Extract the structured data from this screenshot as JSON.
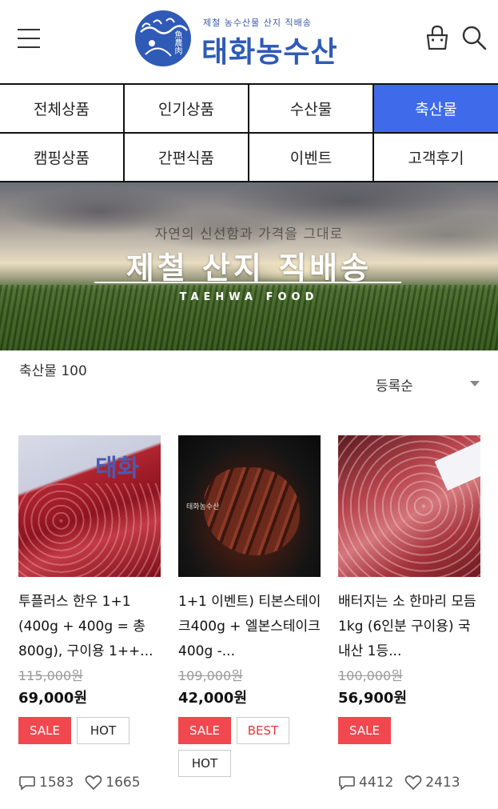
{
  "header": {
    "logo_sub": "제철 농수산물 산지 직배송",
    "logo_main": "태화농수산",
    "logo_emblem_text": "魚農肉"
  },
  "categories": [
    {
      "label": "전체상품",
      "active": false
    },
    {
      "label": "인기상품",
      "active": false
    },
    {
      "label": "수산물",
      "active": false
    },
    {
      "label": "축산물",
      "active": true
    },
    {
      "label": "캠핑상품",
      "active": false
    },
    {
      "label": "간편식품",
      "active": false
    },
    {
      "label": "이벤트",
      "active": false
    },
    {
      "label": "고객후기",
      "active": false
    }
  ],
  "banner": {
    "subtitle": "자연의 신선함과 가격을 그대로",
    "title": "제철 산지 직배송",
    "brand": "TAEHWA FOOD"
  },
  "listing": {
    "count_label": "축산물 100",
    "sort_selected": "등록순"
  },
  "products": [
    {
      "name": "투플러스 한우 1+1 (400g + 400g = 총 800g), 구이용 1++...",
      "original_price": "115,000원",
      "price": "69,000원",
      "badges": [
        "SALE",
        "HOT"
      ],
      "reviews": "1583",
      "likes": "1665",
      "image_logo": "태화"
    },
    {
      "name": "1+1 이벤트) 티본스테이크400g + 엘본스테이크400g -...",
      "original_price": "109,000원",
      "price": "42,000원",
      "badges": [
        "SALE",
        "BEST",
        "HOT"
      ],
      "reviews": "",
      "likes": "",
      "image_logo": "태화농수산"
    },
    {
      "name": "배터지는 소 한마리 모듬 1kg (6인분 구이용) 국내산 1등...",
      "original_price": "100,000원",
      "price": "56,900원",
      "badges": [
        "SALE"
      ],
      "reviews": "4412",
      "likes": "2413",
      "image_logo": ""
    }
  ],
  "colors": {
    "brand": "#2f5bb7",
    "active_tab": "#3f6bea",
    "sale_badge": "#f1474f",
    "best_text": "#e53935"
  }
}
